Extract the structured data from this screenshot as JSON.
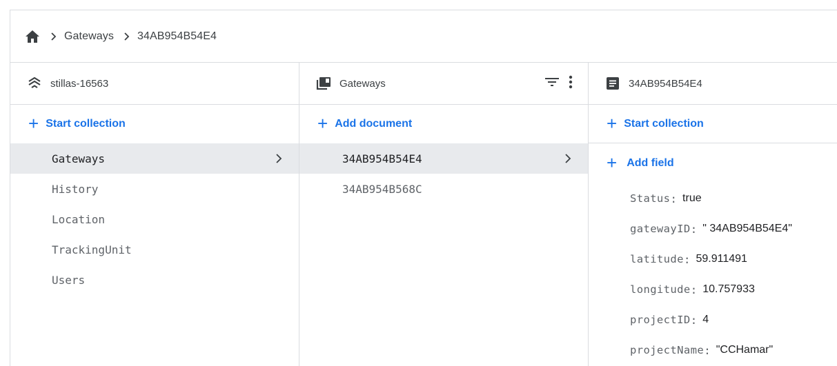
{
  "breadcrumb": {
    "home_icon": "home-icon",
    "items": [
      "Gateways",
      "34AB954B54E4"
    ]
  },
  "panels": {
    "root": {
      "icon": "database-stack-icon",
      "title": "stillas-16563",
      "action": "Start collection",
      "items": [
        {
          "label": "Gateways",
          "selected": true
        },
        {
          "label": "History"
        },
        {
          "label": "Location"
        },
        {
          "label": "TrackingUnit"
        },
        {
          "label": "Users"
        }
      ]
    },
    "collection": {
      "icon": "collection-icon",
      "title": "Gateways",
      "action": "Add document",
      "items": [
        {
          "label": "34AB954B54E4",
          "selected": true
        },
        {
          "label": "34AB954B568C"
        }
      ]
    },
    "document": {
      "icon": "document-icon",
      "title": "34AB954B54E4",
      "action_collection": "Start collection",
      "action_field": "Add field",
      "fields": [
        {
          "key": "Status",
          "value": "true"
        },
        {
          "key": "gatewayID",
          "value": "\" 34AB954B54E4\""
        },
        {
          "key": "latitude",
          "value": "59.911491"
        },
        {
          "key": "longitude",
          "value": "10.757933"
        },
        {
          "key": "projectID",
          "value": "4"
        },
        {
          "key": "projectName",
          "value": "\"CCHamar\""
        }
      ]
    }
  },
  "colors": {
    "accent": "#1a73e8",
    "selected_bg": "#e8eaed",
    "border": "#dadce0"
  }
}
